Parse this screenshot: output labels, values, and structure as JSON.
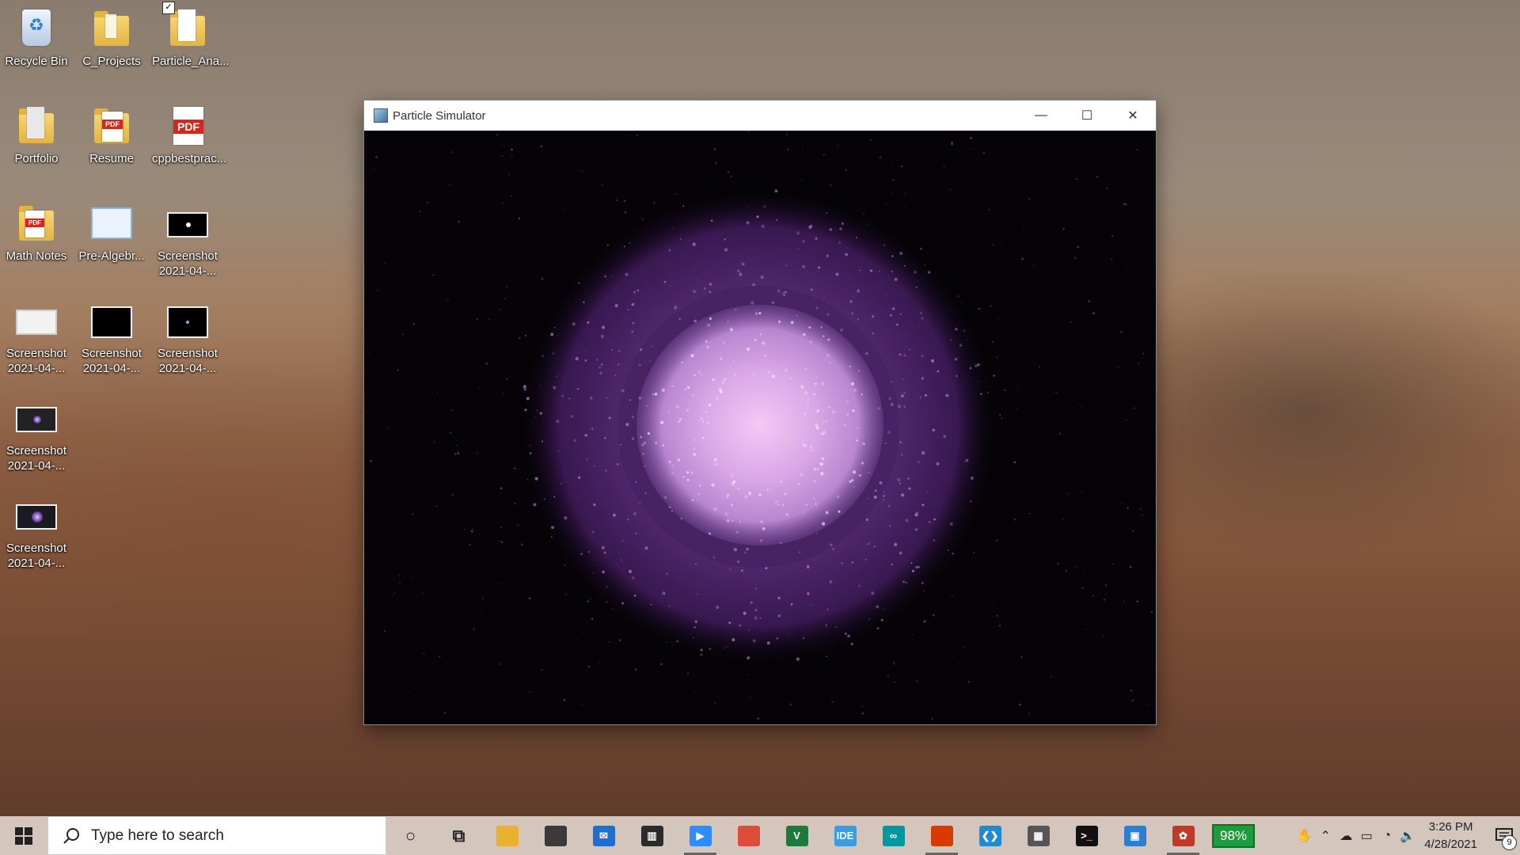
{
  "desktop": {
    "icons": [
      {
        "label": "Recycle Bin"
      },
      {
        "label": "C_Projects"
      },
      {
        "label": "Particle_Ana..."
      },
      {
        "label": "Portfolio"
      },
      {
        "label": "Resume"
      },
      {
        "label": "cppbestprac..."
      },
      {
        "label": "Math Notes"
      },
      {
        "label": "Pre-Algebr..."
      },
      {
        "label": "Screenshot\n2021-04-..."
      },
      {
        "label": "Screenshot\n2021-04-..."
      },
      {
        "label": "Screenshot\n2021-04-..."
      },
      {
        "label": "Screenshot\n2021-04-..."
      },
      {
        "label": "Screenshot\n2021-04-..."
      },
      {
        "label": "Screenshot\n2021-04-..."
      }
    ],
    "pdf_badge": "PDF"
  },
  "window": {
    "title": "Particle Simulator",
    "minimize": "—",
    "maximize": "☐",
    "close": "✕"
  },
  "taskbar": {
    "search_placeholder": "Type here to search",
    "apps": [
      {
        "name": "cortana",
        "glyph": "○",
        "color": "transparent"
      },
      {
        "name": "task-view",
        "glyph": "⧉",
        "color": "transparent"
      },
      {
        "name": "file-explorer",
        "glyph": "",
        "color": "#e8b230"
      },
      {
        "name": "store",
        "glyph": "",
        "color": "#3a3a3a"
      },
      {
        "name": "mail",
        "glyph": "✉",
        "color": "#1f6fd0"
      },
      {
        "name": "calendar-app",
        "glyph": "▥",
        "color": "#2b2b2b"
      },
      {
        "name": "zoom",
        "glyph": "▶",
        "color": "#2d8cff"
      },
      {
        "name": "chrome",
        "glyph": "",
        "color": "#dd4b39"
      },
      {
        "name": "vim",
        "glyph": "V",
        "color": "#1c7a3c"
      },
      {
        "name": "ide",
        "glyph": "IDE",
        "color": "#3b9be3"
      },
      {
        "name": "arduino",
        "glyph": "∞",
        "color": "#00979d"
      },
      {
        "name": "office",
        "glyph": "",
        "color": "#d83b01"
      },
      {
        "name": "vscode",
        "glyph": "❮❯",
        "color": "#1f8ad2"
      },
      {
        "name": "calculator",
        "glyph": "▦",
        "color": "#555555"
      },
      {
        "name": "terminal",
        "glyph": ">_",
        "color": "#111111"
      },
      {
        "name": "paint",
        "glyph": "▣",
        "color": "#2a7fd4"
      },
      {
        "name": "particle-app",
        "glyph": "✿",
        "color": "#c0392b"
      }
    ],
    "battery_percent": "98%",
    "time": "3:26 PM",
    "date": "4/28/2021",
    "notification_count": "9"
  }
}
